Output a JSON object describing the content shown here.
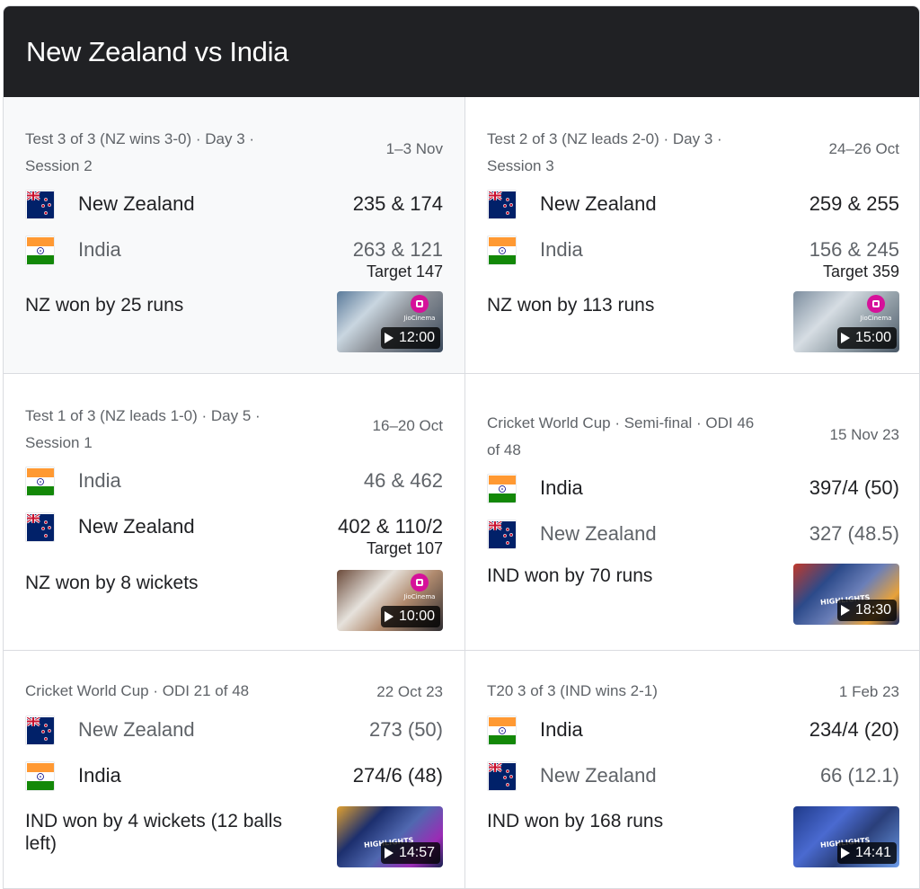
{
  "header": {
    "title": "New Zealand vs India"
  },
  "colors": {
    "header_bg": "#202124",
    "jio_accent": "#d6119a"
  },
  "matches": [
    {
      "meta": "Test 3 of 3 (NZ wins 3-0) · Day 3 · Session 2",
      "date": "1–3 Nov",
      "team1": {
        "name": "New Zealand",
        "flag": "nz-flag-icon",
        "score": "235 & 174"
      },
      "team2": {
        "name": "India",
        "flag": "india-flag-icon",
        "score": "263 & 121"
      },
      "target": "Target 147",
      "result": "NZ won by 25 runs",
      "video": {
        "duration": "12:00",
        "badge": "JioCinema"
      }
    },
    {
      "meta": "Test 2 of 3 (NZ leads 2-0) · Day 3 · Session 3",
      "date": "24–26 Oct",
      "team1": {
        "name": "New Zealand",
        "flag": "nz-flag-icon",
        "score": "259 & 255"
      },
      "team2": {
        "name": "India",
        "flag": "india-flag-icon",
        "score": "156 & 245"
      },
      "target": "Target 359",
      "result": "NZ won by 113 runs",
      "video": {
        "duration": "15:00",
        "badge": "JioCinema"
      }
    },
    {
      "meta": "Test 1 of 3 (NZ leads 1-0) · Day 5 · Session 1",
      "date": "16–20 Oct",
      "team1": {
        "name": "India",
        "flag": "india-flag-icon",
        "score": "46 & 462"
      },
      "team2": {
        "name": "New Zealand",
        "flag": "nz-flag-icon",
        "score": "402 & 110/2"
      },
      "target": "Target 107",
      "result": "NZ won by 8 wickets",
      "video": {
        "duration": "10:00",
        "badge": "JioCinema"
      }
    },
    {
      "meta": "Cricket World Cup · Semi-final · ODI 46 of 48",
      "date": "15 Nov 23",
      "team1": {
        "name": "India",
        "flag": "india-flag-icon",
        "score": "397/4 (50)"
      },
      "team2": {
        "name": "New Zealand",
        "flag": "nz-flag-icon",
        "score": "327 (48.5)"
      },
      "result": "IND won by 70 runs",
      "video": {
        "duration": "18:30"
      }
    },
    {
      "meta": "Cricket World Cup · ODI 21 of 48",
      "date": "22 Oct 23",
      "team1": {
        "name": "New Zealand",
        "flag": "nz-flag-icon",
        "score": "273 (50)"
      },
      "team2": {
        "name": "India",
        "flag": "india-flag-icon",
        "score": "274/6 (48)"
      },
      "result": "IND won by 4 wickets (12 balls left)",
      "video": {
        "duration": "14:57"
      }
    },
    {
      "meta": "T20 3 of 3 (IND wins 2-1)",
      "date": "1 Feb 23",
      "team1": {
        "name": "India",
        "flag": "india-flag-icon",
        "score": "234/4 (20)"
      },
      "team2": {
        "name": "New Zealand",
        "flag": "nz-flag-icon",
        "score": "66 (12.1)"
      },
      "result": "IND won by 168 runs",
      "video": {
        "duration": "14:41"
      }
    }
  ]
}
